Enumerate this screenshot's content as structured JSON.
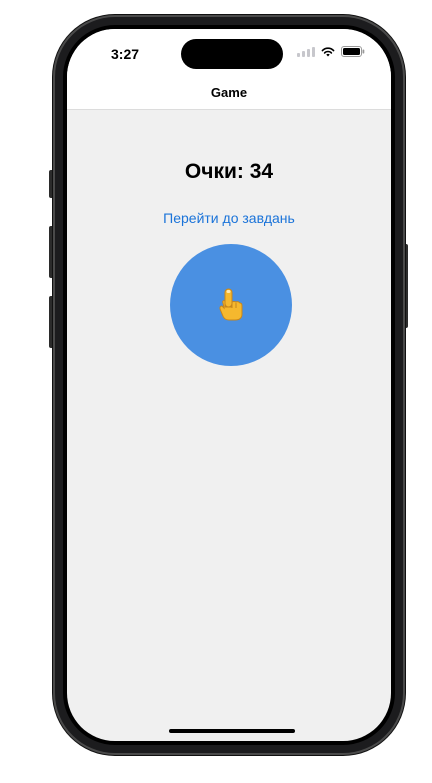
{
  "status_bar": {
    "time": "3:27"
  },
  "nav": {
    "title": "Game"
  },
  "game": {
    "score_label": "Очки: 34",
    "tasks_link": "Перейти до завдань",
    "tap_icon": "pointing-finger-icon"
  },
  "colors": {
    "accent": "#4a90e2",
    "link": "#1a73d9",
    "background": "#f0f0f0"
  }
}
